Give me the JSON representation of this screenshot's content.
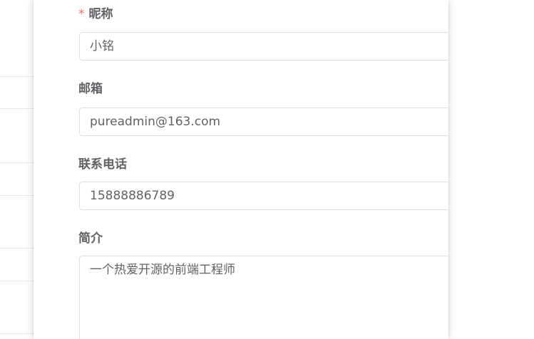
{
  "form": {
    "nickname": {
      "required_mark": "*",
      "label": "昵称",
      "value": "小铭"
    },
    "email": {
      "label": "邮箱",
      "value": "pureadmin@163.com"
    },
    "phone": {
      "label": "联系电话",
      "value": "15888886789"
    },
    "intro": {
      "label": "简介",
      "value": "一个热爱开源的前端工程师"
    }
  },
  "colors": {
    "label": "#606266",
    "required": "#f56c6c",
    "border": "#dcdfe6"
  }
}
